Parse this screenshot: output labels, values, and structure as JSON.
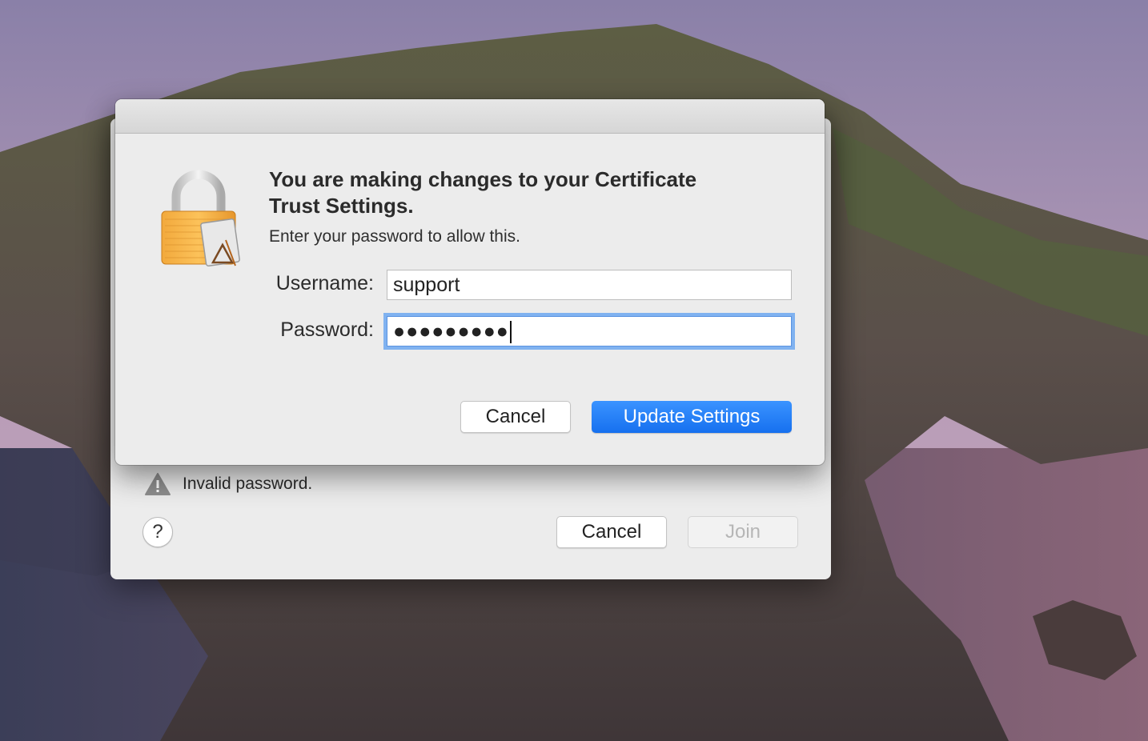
{
  "auth_dialog": {
    "heading": "You are making changes to your Certificate Trust Settings.",
    "subtext": "Enter your password to allow this.",
    "username_label": "Username:",
    "username_value": "support",
    "password_label": "Password:",
    "password_masked": "●●●●●●●●●",
    "cancel_label": "Cancel",
    "confirm_label": "Update Settings",
    "icon": "lock-icon",
    "accent_color": "#1a73f0"
  },
  "back_sheet": {
    "warning_text": "Invalid password.",
    "warning_icon": "warning-icon",
    "help_label": "?",
    "cancel_label": "Cancel",
    "join_label": "Join"
  }
}
